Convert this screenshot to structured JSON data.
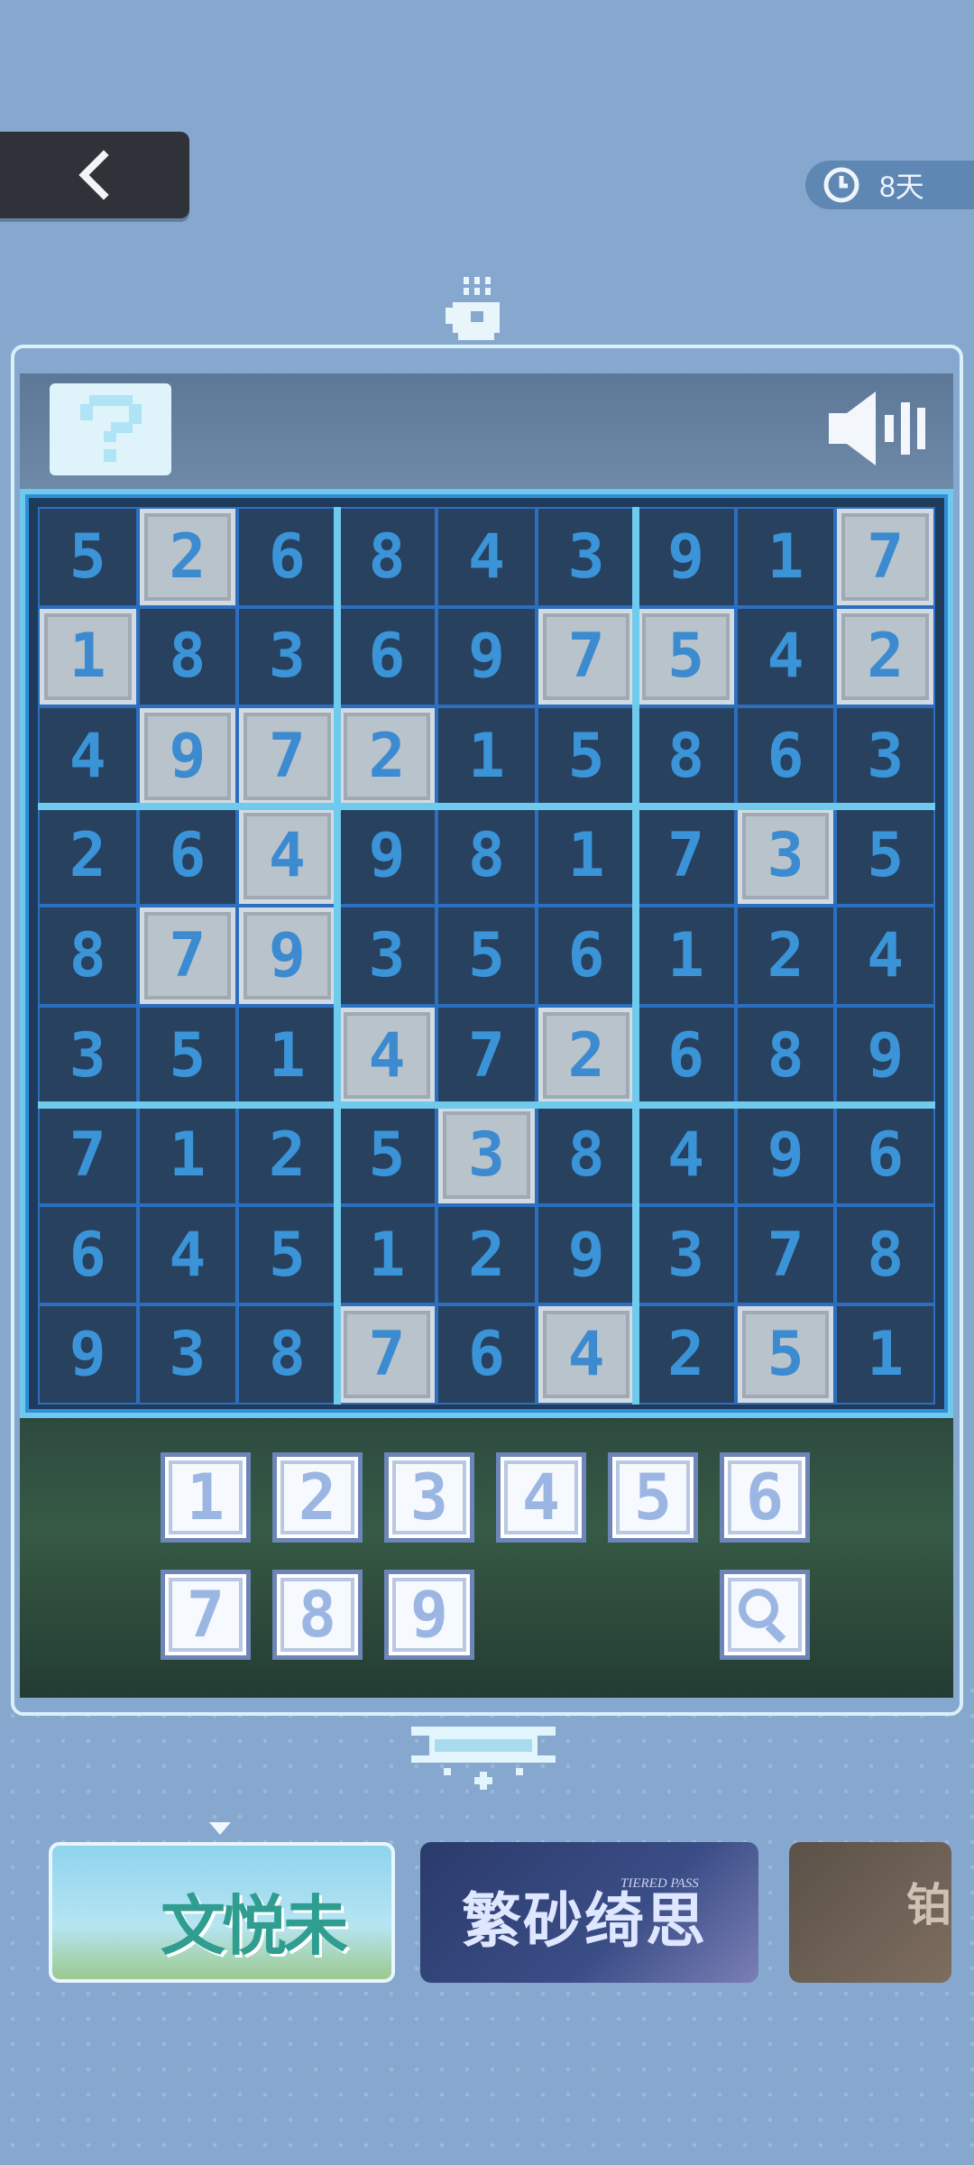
{
  "header": {
    "timer_text": "8天"
  },
  "icons": {
    "back": "chevron-left-icon",
    "clock": "clock-icon",
    "cup": "coffee-cup-icon",
    "help": "question-mark-icon",
    "sound": "speaker-icon",
    "hint": "magnifier-icon"
  },
  "board": {
    "size": 9,
    "rows": [
      [
        5,
        2,
        6,
        8,
        4,
        3,
        9,
        1,
        7
      ],
      [
        1,
        8,
        3,
        6,
        9,
        7,
        5,
        4,
        2
      ],
      [
        4,
        9,
        7,
        2,
        1,
        5,
        8,
        6,
        3
      ],
      [
        2,
        6,
        4,
        9,
        8,
        1,
        7,
        3,
        5
      ],
      [
        8,
        7,
        9,
        3,
        5,
        6,
        1,
        2,
        4
      ],
      [
        3,
        5,
        1,
        4,
        7,
        2,
        6,
        8,
        9
      ],
      [
        7,
        1,
        2,
        5,
        3,
        8,
        4,
        9,
        6
      ],
      [
        6,
        4,
        5,
        1,
        2,
        9,
        3,
        7,
        8
      ],
      [
        9,
        3,
        8,
        7,
        6,
        4,
        2,
        5,
        1
      ]
    ],
    "given": [
      [
        0,
        1
      ],
      [
        0,
        8
      ],
      [
        1,
        0
      ],
      [
        1,
        5
      ],
      [
        1,
        6
      ],
      [
        1,
        8
      ],
      [
        2,
        1
      ],
      [
        2,
        2
      ],
      [
        2,
        3
      ],
      [
        3,
        2
      ],
      [
        3,
        7
      ],
      [
        4,
        1
      ],
      [
        4,
        2
      ],
      [
        5,
        3
      ],
      [
        5,
        5
      ],
      [
        6,
        4
      ],
      [
        8,
        3
      ],
      [
        8,
        5
      ],
      [
        8,
        7
      ]
    ]
  },
  "keypad": {
    "row1": [
      "1",
      "2",
      "3",
      "4",
      "5",
      "6"
    ],
    "row2": [
      "7",
      "8",
      "9"
    ]
  },
  "banners": [
    {
      "title": "文悦未名"
    },
    {
      "title": "繁砂绮思",
      "subtitle": "TIERED PASS"
    },
    {
      "title": "铂"
    }
  ],
  "colors": {
    "background": "#86a8cf",
    "board_border": "#6fcbee",
    "given_cell": "#b9c3cc",
    "digit": "#3b94d8"
  }
}
